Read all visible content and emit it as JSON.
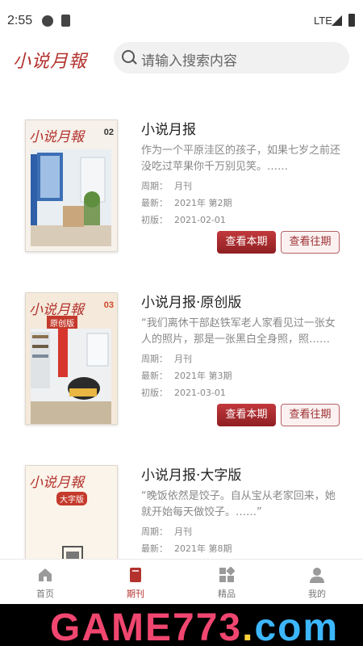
{
  "status": {
    "time": "2:55",
    "network": "LTE"
  },
  "header": {
    "logo": "小说月報",
    "search_placeholder": "请输入搜索内容"
  },
  "colors": {
    "accent": "#b3322e",
    "button_primary": "#a92d30"
  },
  "magazines": [
    {
      "title": "小说月报",
      "excerpt": "作为一个平原洼区的孩子，如果七岁之前还没吃过苹果你千万别见笑。……",
      "period_label": "周期：",
      "period": "月刊",
      "latest_label": "最新：",
      "latest": "2021年 第2期",
      "first_label": "初版：",
      "first": "2021-02-01",
      "cover_title": "小说月報",
      "cover_issue": "02",
      "btn_current": "查看本期",
      "btn_past": "查看往期"
    },
    {
      "title": "小说月报·原创版",
      "excerpt": "“我们离休干部赵铁军老人家看见过一张女人的照片，那是一张黑白全身照，照……",
      "period_label": "周期：",
      "period": "月刊",
      "latest_label": "最新：",
      "latest": "2021年 第3期",
      "first_label": "初版：",
      "first": "2021-03-01",
      "cover_title": "小说月報",
      "cover_issue": "03",
      "cover_sub": "原创版",
      "btn_current": "查看本期",
      "btn_past": "查看往期"
    },
    {
      "title": "小说月报·大字版",
      "excerpt": "“晚饭依然是饺子。自从宝从老家回来，她就开始每天做饺子。……”",
      "period_label": "周期：",
      "period": "月刊",
      "latest_label": "最新：",
      "latest": "2021年 第8期",
      "cover_title": "小说月報",
      "cover_sub": "大字版"
    }
  ],
  "tabs": [
    {
      "label": "首页",
      "icon": "home-icon"
    },
    {
      "label": "期刊",
      "icon": "book-icon",
      "active": true
    },
    {
      "label": "精品",
      "icon": "grid-icon"
    },
    {
      "label": "我的",
      "icon": "user-icon"
    }
  ],
  "banner": {
    "text_main": "GAME773",
    "text_dot": ".",
    "text_com": "com"
  }
}
